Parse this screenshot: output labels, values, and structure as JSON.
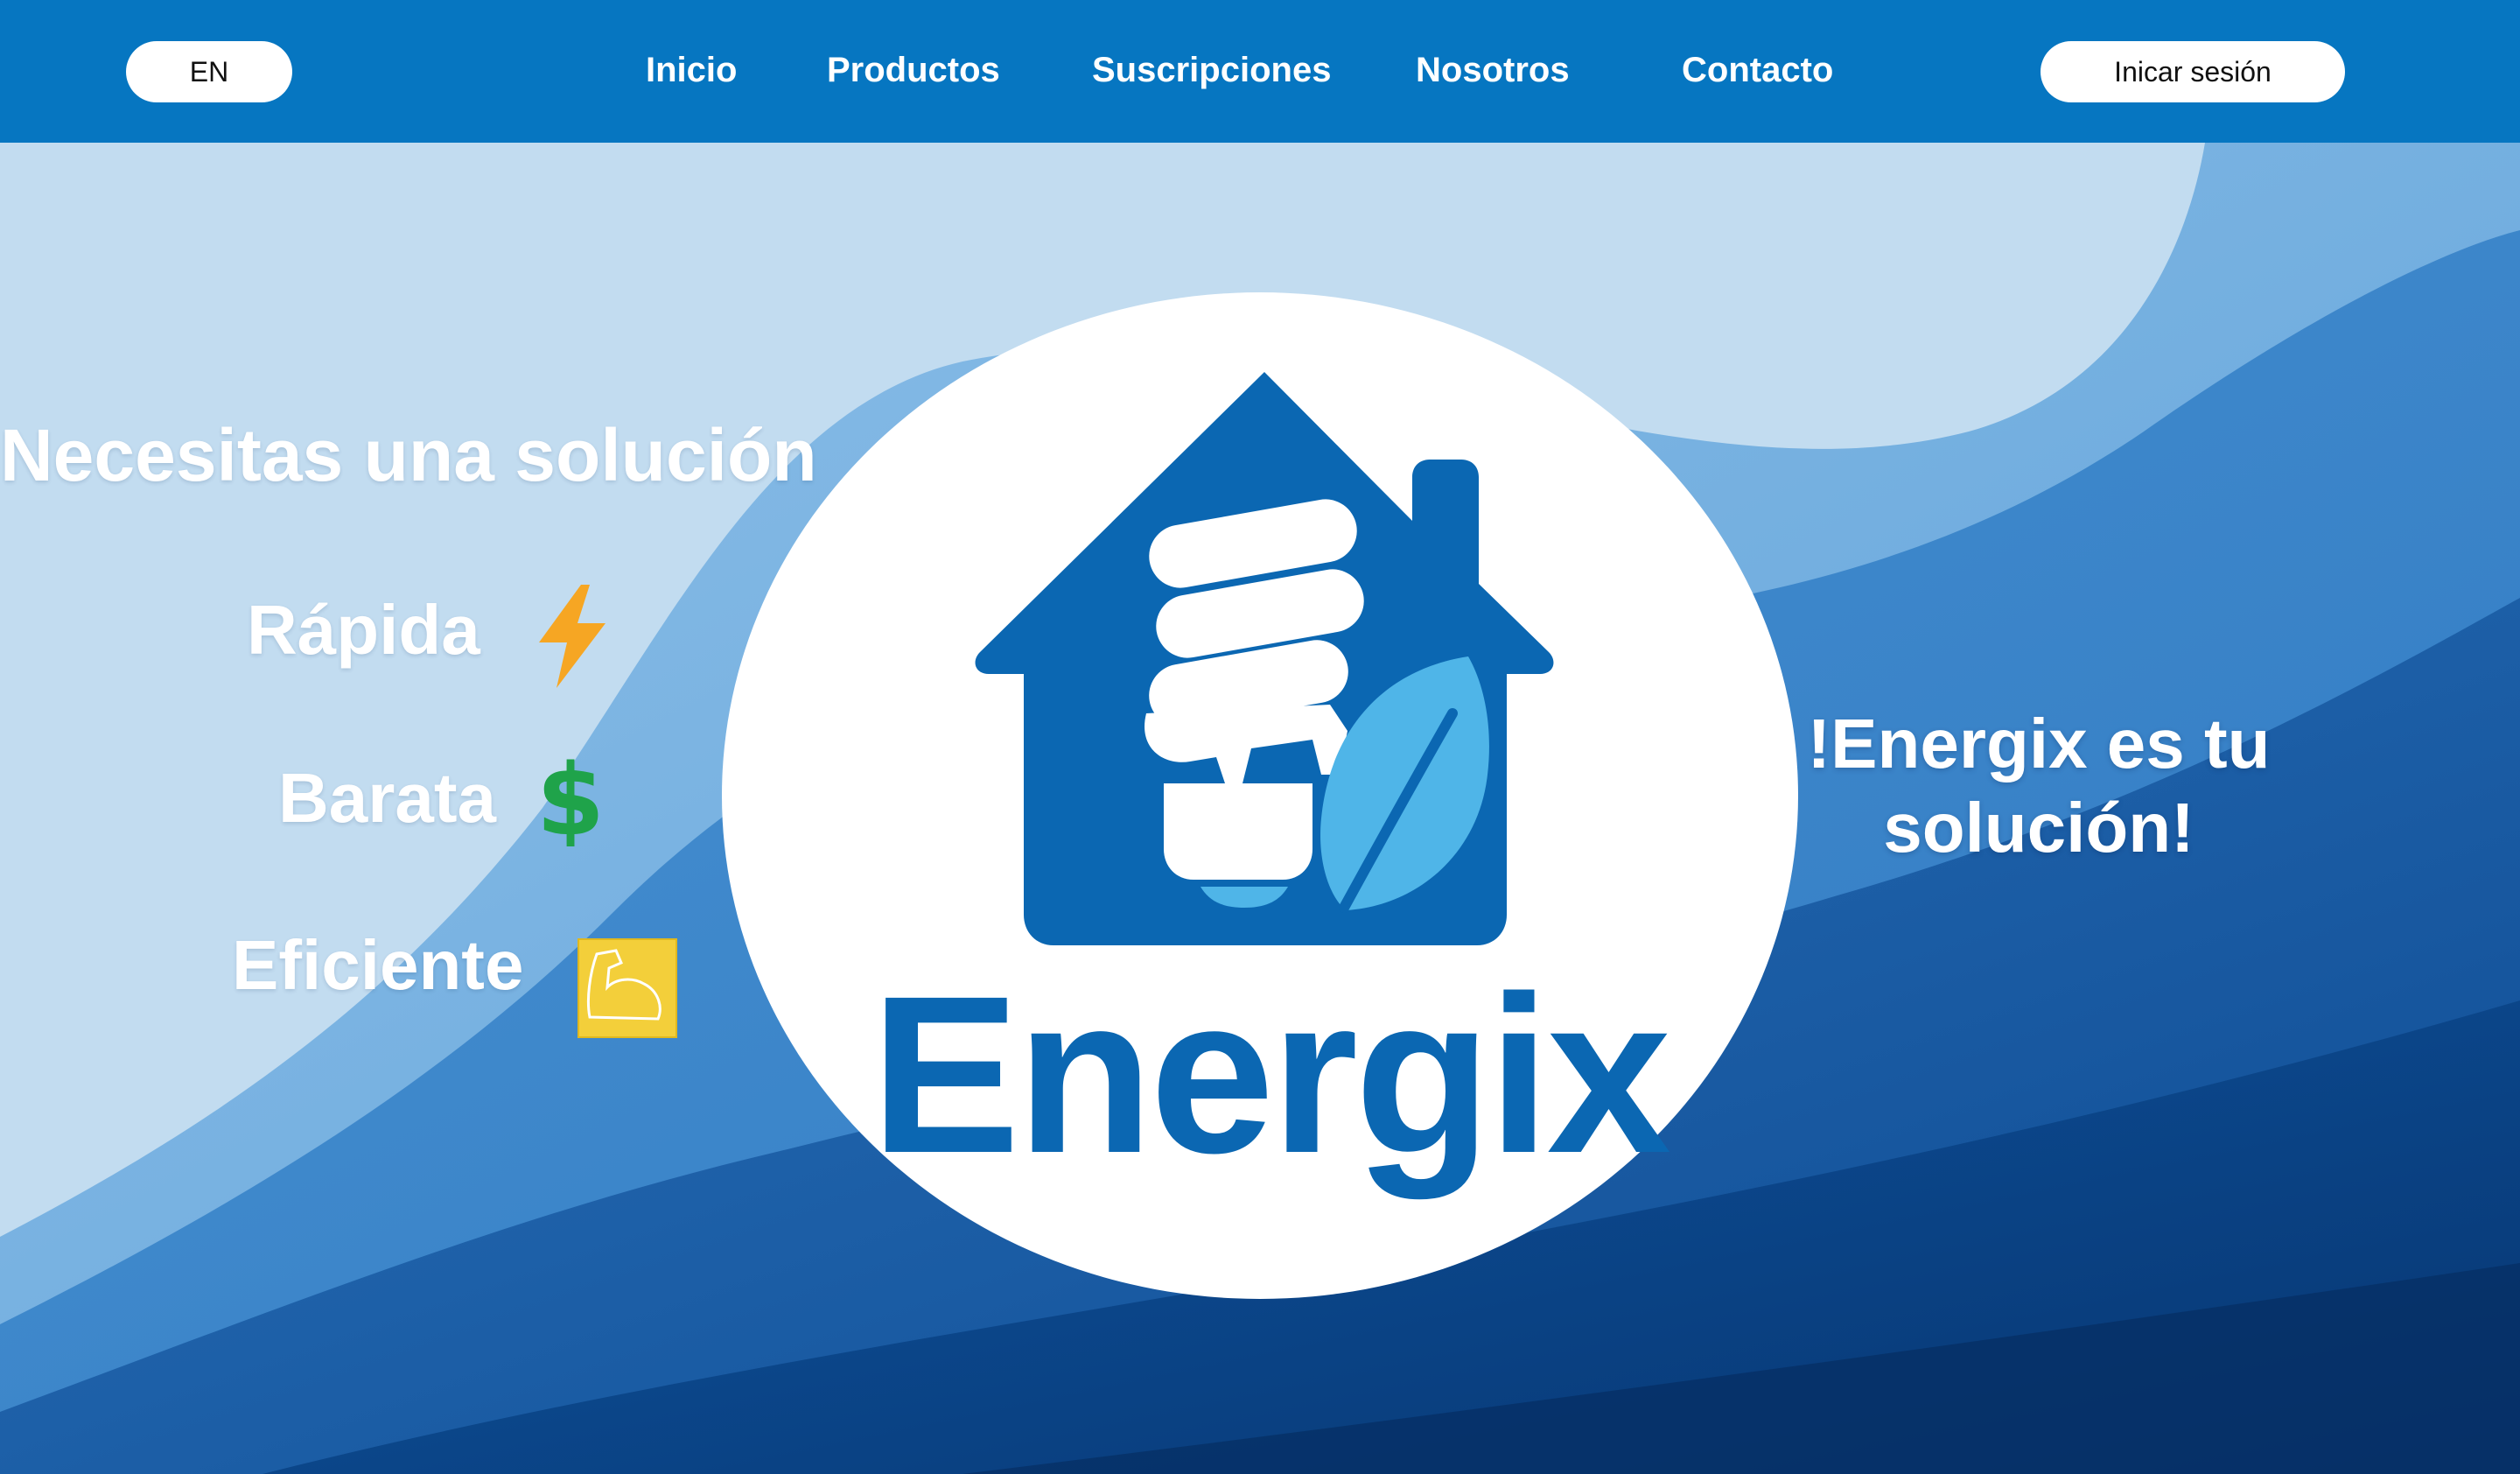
{
  "header": {
    "language_label": "EN",
    "nav": [
      {
        "label": "Inicio"
      },
      {
        "label": "Productos"
      },
      {
        "label": "Suscripciones"
      },
      {
        "label": "Nosotros"
      },
      {
        "label": "Contacto"
      }
    ],
    "login_label": "Inicar sesión"
  },
  "hero": {
    "headline": "Necesitas una solución",
    "features": [
      {
        "label": "Rápida",
        "icon": "lightning-icon"
      },
      {
        "label": "Barata",
        "icon": "dollar-icon"
      },
      {
        "label": "Eficiente",
        "icon": "flexed-biceps-icon"
      }
    ],
    "logo_text": "Energix",
    "tagline": "!Energix es tu solución!"
  },
  "colors": {
    "header_bg": "#0676c1",
    "brand_blue": "#0b67b2",
    "leaf_blue": "#4fb5e8",
    "hero_light": "#c2dcf0",
    "hero_dark": "#0a3f85"
  }
}
